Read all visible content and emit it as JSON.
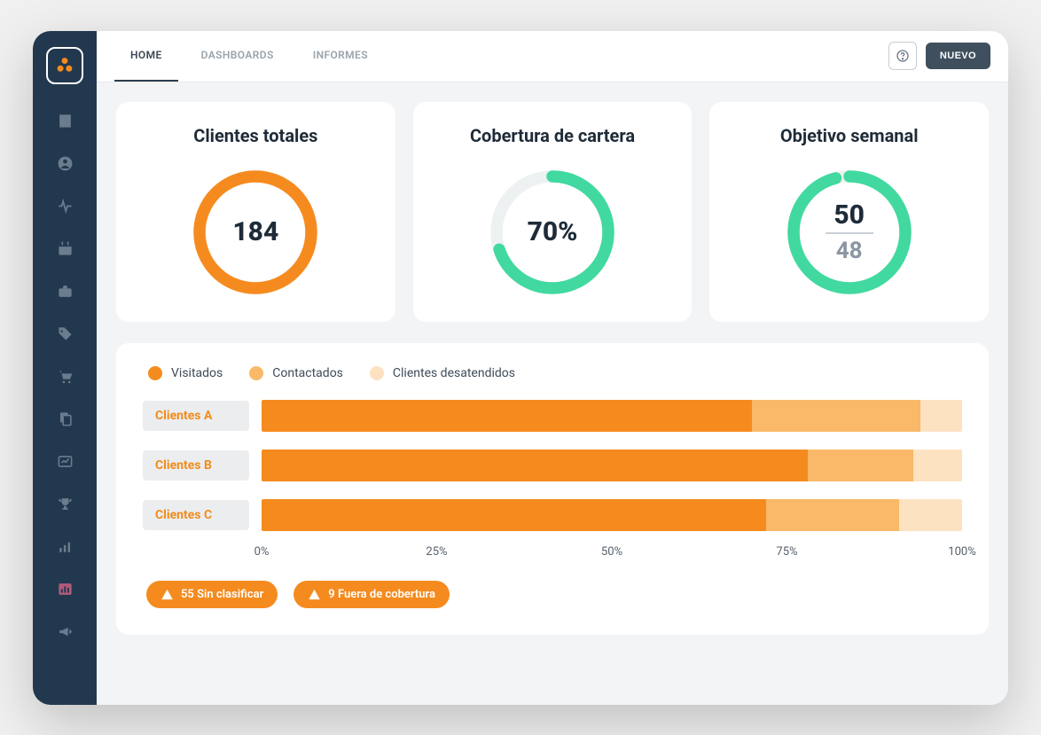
{
  "tabs": {
    "home": "HOME",
    "dashboards": "DASHBOARDS",
    "reports": "INFORMES"
  },
  "topbar": {
    "new_label": "NUEVO"
  },
  "cards": {
    "total_clients_title": "Clientes totales",
    "total_clients_value": "184",
    "coverage_title": "Cobertura de cartera",
    "coverage_value": "70%",
    "coverage_pct": 70,
    "weekly_title": "Objetivo semanal",
    "weekly_target": "50",
    "weekly_actual": "48",
    "weekly_pct": 96
  },
  "legend": {
    "visited": "Visitados",
    "contacted": "Contactados",
    "unattended": "Clientes desatendidos"
  },
  "colors": {
    "orange": "#f58b1f",
    "orange_mid": "#f9b968",
    "orange_light": "#fde2c2",
    "teal": "#41d9a0"
  },
  "axis": {
    "p0": "0%",
    "p25": "25%",
    "p50": "50%",
    "p75": "75%",
    "p100": "100%"
  },
  "alerts": {
    "unclassified": "55 Sin clasificar",
    "out_of_coverage": "9 Fuera de cobertura"
  },
  "chart_data": {
    "type": "bar",
    "stacked": true,
    "orientation": "horizontal",
    "xlabel": "",
    "ylabel": "",
    "xlim": [
      0,
      100
    ],
    "x_ticks": [
      0,
      25,
      50,
      75,
      100
    ],
    "categories": [
      "Clientes A",
      "Clientes B",
      "Clientes C"
    ],
    "series": [
      {
        "name": "Visitados",
        "color": "#f58b1f",
        "values": [
          70,
          78,
          72
        ]
      },
      {
        "name": "Contactados",
        "color": "#f9b968",
        "values": [
          24,
          15,
          19
        ]
      },
      {
        "name": "Clientes desatendidos",
        "color": "#fde2c2",
        "values": [
          6,
          7,
          9
        ]
      }
    ]
  }
}
